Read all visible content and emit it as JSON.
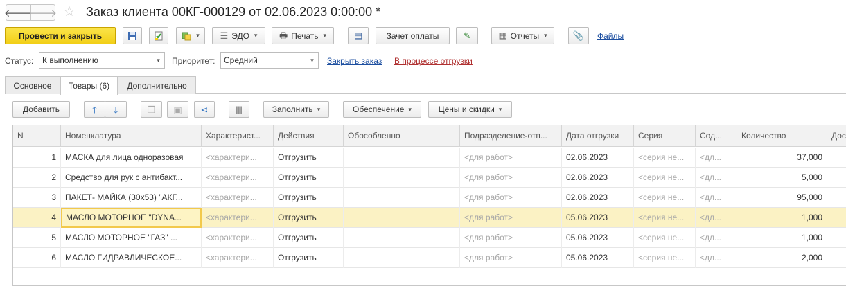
{
  "window": {
    "title": "Заказ клиента 00КГ-000129 от 02.06.2023 0:00:00 *",
    "back_glyph": "🡐",
    "forward_glyph": "🡒",
    "star_glyph": "☆"
  },
  "toolbar": {
    "post_close": "Провести и закрыть",
    "edo": "ЭДО",
    "print": "Печать",
    "payment_offset": "Зачет оплаты",
    "reports": "Отчеты",
    "files": "Файлы"
  },
  "status": {
    "status_label": "Статус:",
    "status_value": "К выполнению",
    "priority_label": "Приоритет:",
    "priority_value": "Средний",
    "close_order_link": "Закрыть заказ",
    "shipment_link": "В процессе отгрузки"
  },
  "tabs": [
    {
      "label": "Основное",
      "active": false
    },
    {
      "label": "Товары (6)",
      "active": true
    },
    {
      "label": "Дополнительно",
      "active": false
    }
  ],
  "table_toolbar": {
    "add": "Добавить",
    "fill": "Заполнить",
    "provision": "Обеспечение",
    "prices_discounts": "Цены и скидки"
  },
  "table": {
    "columns": [
      "N",
      "Номенклатура",
      "Характерист...",
      "Действия",
      "Обособленно",
      "Подразделение-отп...",
      "Дата отгрузки",
      "Серия",
      "Сод...",
      "Количество",
      "Дос"
    ],
    "rows": [
      {
        "n": "1",
        "item": "МАСКА для лица одноразовая",
        "char": "<характери...",
        "action": "Отгрузить",
        "separate": "",
        "dept": "<для работ>",
        "date": "02.06.2023",
        "series": "<серия не...",
        "content": "<дл...",
        "qty": "37,000",
        "selected": false
      },
      {
        "n": "2",
        "item": "Средство для рук с антибакт...",
        "char": "<характери...",
        "action": "Отгрузить",
        "separate": "",
        "dept": "<для работ>",
        "date": "02.06.2023",
        "series": "<серия не...",
        "content": "<дл...",
        "qty": "5,000",
        "selected": false
      },
      {
        "n": "3",
        "item": "ПАКЕТ- МАЙКА (30х53) \"АКГ...",
        "char": "<характери...",
        "action": "Отгрузить",
        "separate": "",
        "dept": "<для работ>",
        "date": "02.06.2023",
        "series": "<серия не...",
        "content": "<дл...",
        "qty": "95,000",
        "selected": false
      },
      {
        "n": "4",
        "item": "МАСЛО МОТОРНОЕ \"DYNA...",
        "char": "<характери...",
        "action": "Отгрузить",
        "separate": "",
        "dept": "<для работ>",
        "date": "05.06.2023",
        "series": "<серия не...",
        "content": "<дл...",
        "qty": "1,000",
        "selected": true
      },
      {
        "n": "5",
        "item": "МАСЛО МОТОРНОЕ  \"ГАЗ\" ...",
        "char": "<характери...",
        "action": "Отгрузить",
        "separate": "",
        "dept": "<для работ>",
        "date": "05.06.2023",
        "series": "<серия не...",
        "content": "<дл...",
        "qty": "1,000",
        "selected": false
      },
      {
        "n": "6",
        "item": "МАСЛО ГИДРАВЛИЧЕСКОЕ...",
        "char": "<характери...",
        "action": "Отгрузить",
        "separate": "",
        "dept": "<для работ>",
        "date": "05.06.2023",
        "series": "<серия не...",
        "content": "<дл...",
        "qty": "2,000",
        "selected": false
      }
    ]
  },
  "colors": {
    "primary_button": "#f2cf17",
    "selected_row": "#fbf2c4",
    "link_blue": "#1d4fa0",
    "link_red": "#b03030"
  }
}
